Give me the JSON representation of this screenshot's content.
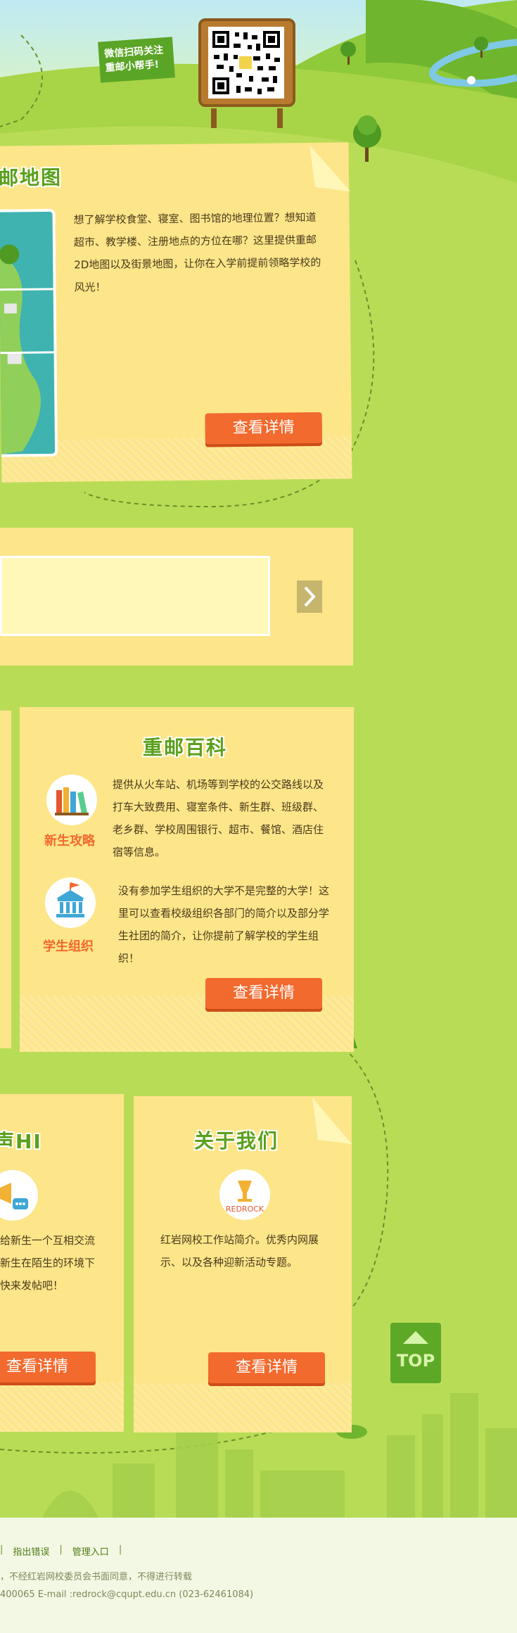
{
  "header": {
    "wechat_line1": "微信扫码关注",
    "wechat_line2": "重邮小帮手!"
  },
  "map_card": {
    "title": "邮地图",
    "text": "想了解学校食堂、寝室、图书馆的地理位置？想知道超市、教学楼、注册地点的方位在哪？这里提供重邮2D地图以及街景地图，让你在入学前提前领略学校的风光！",
    "button": "查看详情"
  },
  "wiki_card": {
    "title": "重邮百科",
    "items": [
      {
        "label": "新生攻略",
        "icon": "books-icon",
        "text": "提供从火车站、机场等到学校的公交路线以及打车大致费用、寝室条件、新生群、班级群、老乡群、学校周围银行、超市、餐馆、酒店住宿等信息。"
      },
      {
        "label": "学生组织",
        "icon": "building-icon",
        "text": "没有参加学生组织的大学不是完整的大学！这里可以查看校级组织各部门的简介以及部分学生社团的简介，让你提前了解学校的学生组织！"
      }
    ],
    "button": "查看详情"
  },
  "hi_card": {
    "title": "声HI",
    "text_lines": [
      "给新生一个互相交流",
      "新生在陌生的环境下",
      "快来发帖吧！"
    ],
    "button": "查看详情"
  },
  "about_card": {
    "title": "关于我们",
    "logo_text": "REDROCK",
    "text": "红岩网校工作站简介。优秀内网展示、以及各种迎新活动专题。",
    "button": "查看详情"
  },
  "top_button": {
    "label": "TOP"
  },
  "footer": {
    "links": [
      "指出错误",
      "管理入口"
    ],
    "separator": "|",
    "copyright": "，不经红岩网校委员会书面同意，不得进行转载",
    "contact": "400065 E-mail :redrock@cqupt.edu.cn (023-62461084)"
  },
  "colors": {
    "grass": "#b8dc55",
    "card": "#fde58a",
    "button": "#f26a2e",
    "title_green": "#5aa01c",
    "footer_bg": "#f3f8e4"
  }
}
